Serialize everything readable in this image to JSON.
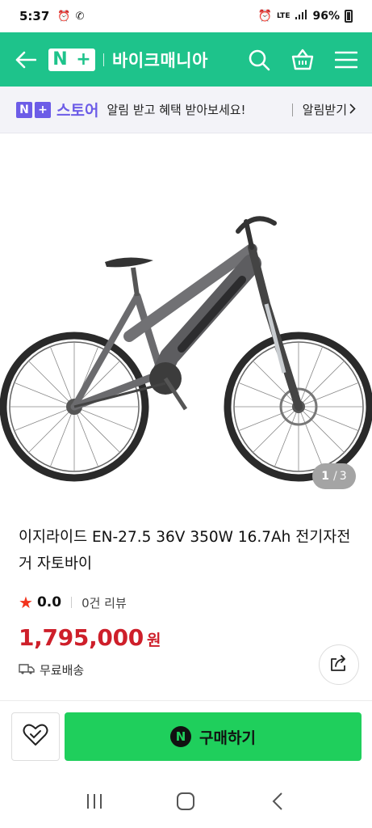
{
  "status_bar": {
    "time": "5:37",
    "network": "LTE",
    "battery": "96%"
  },
  "header": {
    "logo_text": "N+",
    "store_name": "바이크매니아",
    "icons": [
      "back-arrow-icon",
      "search-icon",
      "shopping-basket-icon",
      "menu-icon"
    ],
    "bg_color": "#1ec38b"
  },
  "banner": {
    "logo_label": "스토어",
    "message": "알림 받고 혜택 받아보세요!",
    "link_label": "알림받기",
    "accent_color": "#6c5ce7"
  },
  "gallery": {
    "current": "1",
    "separator": "/",
    "total": "3"
  },
  "product": {
    "title": "이지라이드 EN-27.5 36V 350W 16.7Ah 전기자전거 자토바이",
    "rating_score": "0.0",
    "review_count": "0건 리뷰",
    "price": "1,795,000",
    "currency": "원",
    "shipping": "무료배송",
    "price_color": "#ce1f2a"
  },
  "buy_bar": {
    "buy_label": "구매하기",
    "buy_color": "#1fcf5c"
  }
}
